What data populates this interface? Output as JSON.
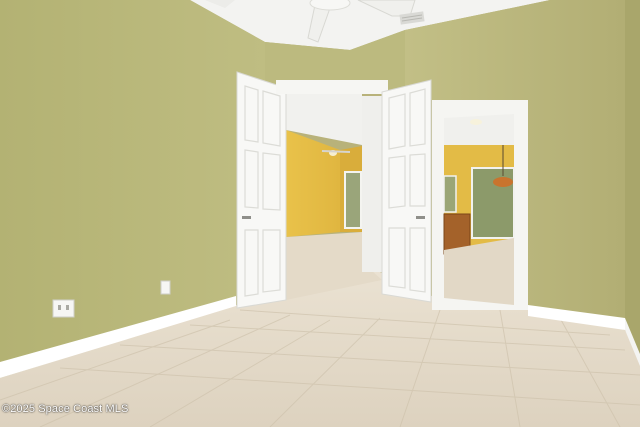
{
  "photo": {
    "watermark": "©2025 Space Coast MLS",
    "colors": {
      "wall_green": "#b9b77b",
      "wall_green_dark": "#aaa86e",
      "ceiling": "#f2f2f0",
      "floor_tile": "#e6dccb",
      "baseboard": "#ffffff",
      "door": "#f7f7f5",
      "hall_wall_yellow": "#e6bf45",
      "cabinet_wood": "#a8652a"
    }
  }
}
